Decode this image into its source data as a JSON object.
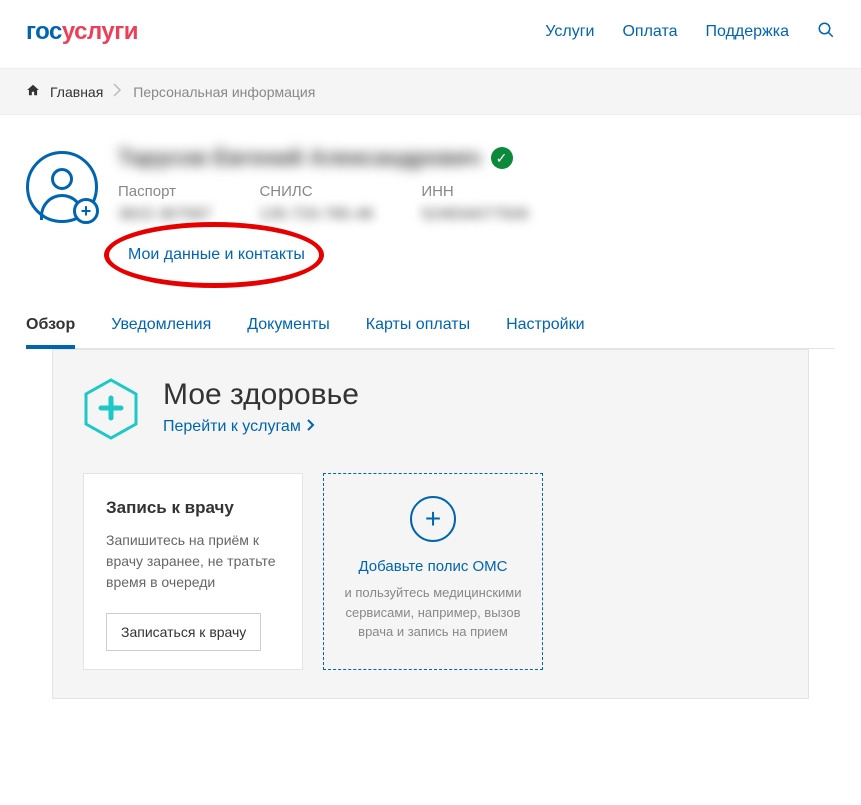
{
  "header": {
    "logo_part1": "гос",
    "logo_part2": "услуги",
    "nav": {
      "services": "Услуги",
      "payment": "Оплата",
      "support": "Поддержка"
    }
  },
  "breadcrumb": {
    "home": "Главная",
    "current": "Персональная информация"
  },
  "profile": {
    "name": "Тарусов Евгений Александрович",
    "docs": {
      "passport_label": "Паспорт",
      "passport_value": "3815 367587",
      "snils_label": "СНИЛС",
      "snils_value": "135-733-785-48",
      "inn_label": "ИНН",
      "inn_value": "524834077509"
    },
    "contacts_link": "Мои данные и контакты"
  },
  "tabs": {
    "overview": "Обзор",
    "notifications": "Уведомления",
    "documents": "Документы",
    "payment_cards": "Карты оплаты",
    "settings": "Настройки"
  },
  "health": {
    "title": "Мое здоровье",
    "link": "Перейти к услугам",
    "card1": {
      "title": "Запись к врачу",
      "text": "Запишитесь на приём к врачу заранее, не тратьте время в очереди",
      "button": "Записаться к врачу"
    },
    "card2": {
      "link": "Добавьте полис ОМС",
      "text": "и пользуйтесь медицинскими сервисами, например, вызов врача и запись на прием"
    }
  }
}
